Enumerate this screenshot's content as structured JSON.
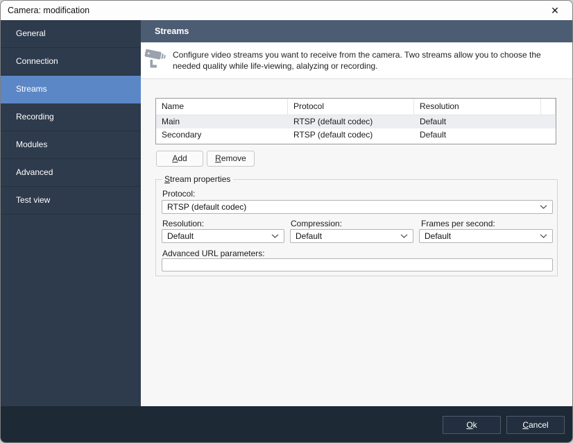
{
  "window": {
    "title": "Camera: modification",
    "close_icon": "✕"
  },
  "sidebar": {
    "items": [
      {
        "label": "General"
      },
      {
        "label": "Connection"
      },
      {
        "label": "Streams",
        "selected": true
      },
      {
        "label": "Recording"
      },
      {
        "label": "Modules"
      },
      {
        "label": "Advanced"
      },
      {
        "label": "Test view"
      }
    ]
  },
  "content": {
    "header_title": "Streams",
    "description": "Configure video streams you want to receive from the camera. Two streams allow you to choose the needed quality while life-viewing, alalyzing or recording.",
    "camera_icon": "cctv-camera-icon"
  },
  "streams_table": {
    "columns": [
      "Name",
      "Protocol",
      "Resolution"
    ],
    "rows": [
      {
        "name": "Main",
        "protocol": "RTSP (default codec)",
        "resolution": "Default",
        "selected": true
      },
      {
        "name": "Secondary",
        "protocol": "RTSP (default codec)",
        "resolution": "Default",
        "selected": false
      }
    ]
  },
  "toolbar": {
    "add": {
      "key": "A",
      "rest": "dd"
    },
    "remove": {
      "key": "R",
      "rest": "emove"
    }
  },
  "stream_properties": {
    "group_label": {
      "key": "S",
      "rest": "tream properties"
    },
    "protocol": {
      "label": "Protocol:",
      "value": "RTSP (default codec)"
    },
    "resolution": {
      "label": "Resolution:",
      "value": "Default"
    },
    "compression": {
      "label": "Compression:",
      "value": "Default"
    },
    "frames_per_second": {
      "label": "Frames per second:",
      "value": "Default"
    },
    "advanced_url": {
      "label": "Advanced URL parameters:",
      "value": ""
    }
  },
  "footer": {
    "ok": {
      "key": "O",
      "rest": "k"
    },
    "cancel": {
      "key": "C",
      "rest": "ancel"
    }
  },
  "colors": {
    "titlebar_bg": "#FDFDFD",
    "sidebar_bg": "#2E3B4D",
    "sidebar_selected": "#5C87C6",
    "section_header_bg": "#4C5D73",
    "content_bg": "#F7F7F8",
    "row_selected_bg": "#ECEEF2",
    "footer_bg": "#1E2936",
    "footer_button_bg": "#232F3F"
  }
}
